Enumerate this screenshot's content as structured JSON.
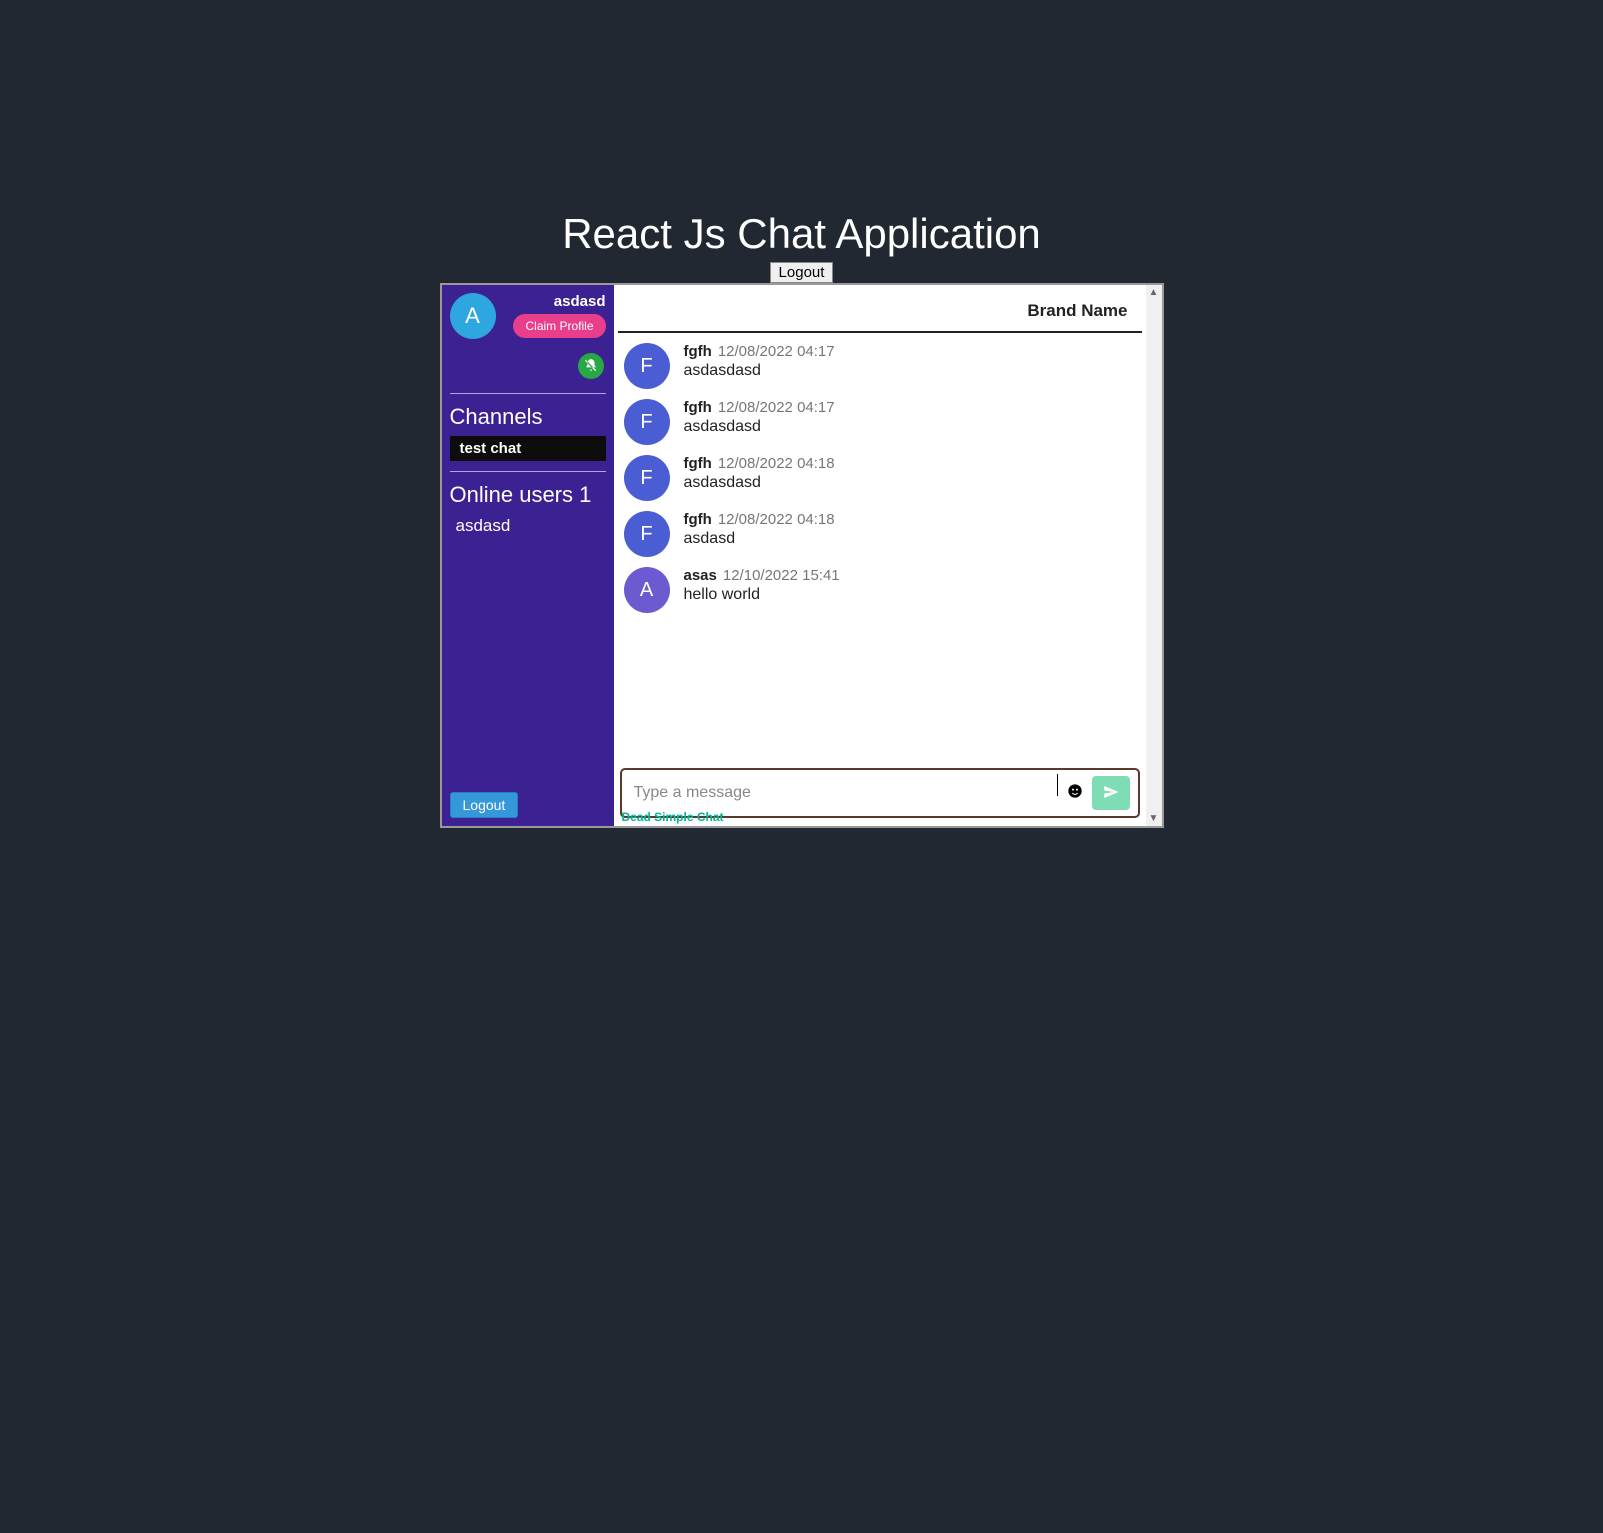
{
  "page": {
    "title": "React Js Chat Application",
    "top_logout_label": "Logout"
  },
  "sidebar": {
    "username": "asdasd",
    "avatar_letter": "A",
    "claim_profile_label": "Claim Profile",
    "channels_title": "Channels",
    "channels": [
      {
        "label": "test chat"
      }
    ],
    "online_title_prefix": "Online users",
    "online_count": "1",
    "online_users": [
      {
        "name": "asdasd"
      }
    ],
    "logout_label": "Logout"
  },
  "brand": "Brand Name",
  "messages": [
    {
      "author": "fgfh",
      "time": "12/08/2022 04:17",
      "text": "asdasdasd",
      "avatar_letter": "F",
      "avatar_class": "avatar-blue"
    },
    {
      "author": "fgfh",
      "time": "12/08/2022 04:17",
      "text": "asdasdasd",
      "avatar_letter": "F",
      "avatar_class": "avatar-blue"
    },
    {
      "author": "fgfh",
      "time": "12/08/2022 04:18",
      "text": "asdasdasd",
      "avatar_letter": "F",
      "avatar_class": "avatar-blue"
    },
    {
      "author": "fgfh",
      "time": "12/08/2022 04:18",
      "text": "asdasd",
      "avatar_letter": "F",
      "avatar_class": "avatar-blue"
    },
    {
      "author": "asas",
      "time": "12/10/2022 15:41",
      "text": "hello world",
      "avatar_letter": "A",
      "avatar_class": "avatar-purple"
    }
  ],
  "compose": {
    "placeholder": "Type a message"
  },
  "footer": {
    "link_label": "Dead Simple Chat"
  }
}
